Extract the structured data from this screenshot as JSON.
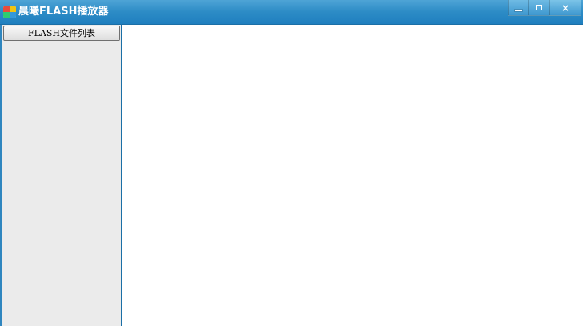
{
  "window": {
    "title": "晨曦FLASH播放器",
    "icon": "app-colorful-icon"
  },
  "titlebar_buttons": {
    "minimize": "minimize-icon",
    "maximize": "maximize-icon",
    "close": "close-icon",
    "close_glyph": "×"
  },
  "sidebar": {
    "header": "FLASH文件列表",
    "items": []
  },
  "colors": {
    "titlebar": "#2d8cc6",
    "sidebar_bg": "#ebebeb",
    "content_bg": "#ffffff"
  }
}
